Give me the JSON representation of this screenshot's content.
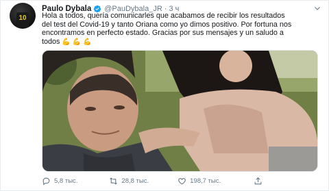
{
  "author": {
    "name": "Paulo Dybala",
    "handle": "@PauDybala_JR",
    "separator": "·",
    "time": "3 ч",
    "avatar_number": "10"
  },
  "tweet": {
    "line1": "Hola a todos, quería comunicarles que acabamos de recibir los resultados",
    "line2": "del test del Covid-19 y tanto Oriana como yo dimos positivo. Por fortuna nos",
    "line3": "encontramos en perfecto estado. Gracias por sus mensajes y un saludo a",
    "line4": "todos",
    "emoji_names": [
      "flexed-biceps",
      "flexed-biceps",
      "flexed-biceps"
    ]
  },
  "actions": {
    "replies": "5,8 тыс.",
    "retweets": "28,8 тыс.",
    "likes": "198,7 тыс."
  },
  "colors": {
    "text": "#14171a",
    "secondary": "#657786",
    "verified": "#1da1f2"
  },
  "icons": [
    "verified-icon",
    "caret-down-icon",
    "reply-icon",
    "retweet-icon",
    "like-icon",
    "share-icon"
  ]
}
